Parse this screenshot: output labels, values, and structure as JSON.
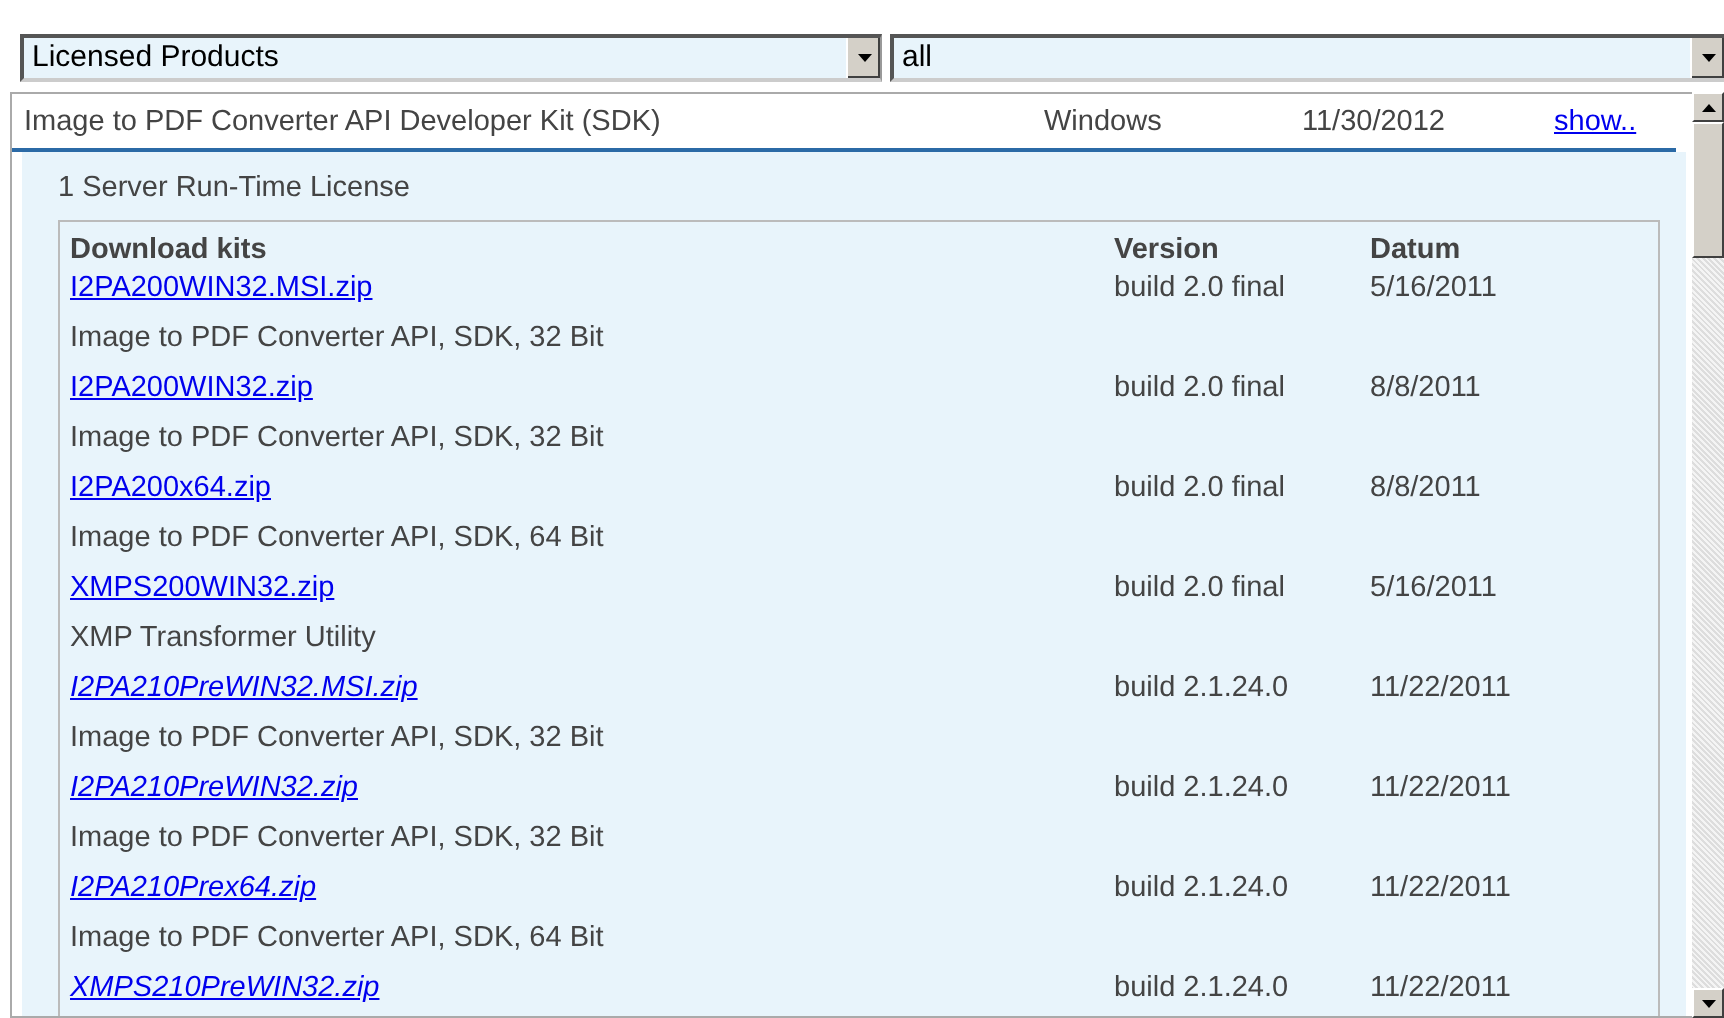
{
  "filters": [
    {
      "value": "Licensed Products"
    },
    {
      "value": "all"
    }
  ],
  "product": {
    "name": "Image to PDF Converter API Developer Kit (SDK)",
    "platform": "Windows",
    "date": "11/30/2012",
    "action": "show.."
  },
  "license": "1 Server Run-Time License",
  "table": {
    "columns": [
      "Download kits",
      "Version",
      "Datum"
    ],
    "rows": [
      {
        "file": "I2PA200WIN32.MSI.zip",
        "kind": "final",
        "description": "Image to PDF Converter API, SDK, 32 Bit",
        "version": "build 2.0 final",
        "date": "5/16/2011"
      },
      {
        "file": "I2PA200WIN32.zip",
        "kind": "final",
        "description": "Image to PDF Converter API, SDK, 32 Bit",
        "version": "build 2.0 final",
        "date": "8/8/2011"
      },
      {
        "file": "I2PA200x64.zip",
        "kind": "final",
        "description": "Image to PDF Converter API, SDK, 64 Bit",
        "version": "build 2.0 final",
        "date": "8/8/2011"
      },
      {
        "file": "XMPS200WIN32.zip",
        "kind": "final",
        "description": "XMP Transformer Utility",
        "version": "build 2.0 final",
        "date": "5/16/2011"
      },
      {
        "file": "I2PA210PreWIN32.MSI.zip",
        "kind": "pre",
        "description": "Image to PDF Converter API, SDK, 32 Bit",
        "version": "build 2.1.24.0",
        "date": "11/22/2011"
      },
      {
        "file": "I2PA210PreWIN32.zip",
        "kind": "pre",
        "description": "Image to PDF Converter API, SDK, 32 Bit",
        "version": "build 2.1.24.0",
        "date": "11/22/2011"
      },
      {
        "file": "I2PA210Prex64.zip",
        "kind": "pre",
        "description": "Image to PDF Converter API, SDK, 64 Bit",
        "version": "build 2.1.24.0",
        "date": "11/22/2011"
      },
      {
        "file": "XMPS210PreWIN32.zip",
        "kind": "pre",
        "version": "build 2.1.24.0",
        "date": "11/22/2011"
      }
    ]
  }
}
